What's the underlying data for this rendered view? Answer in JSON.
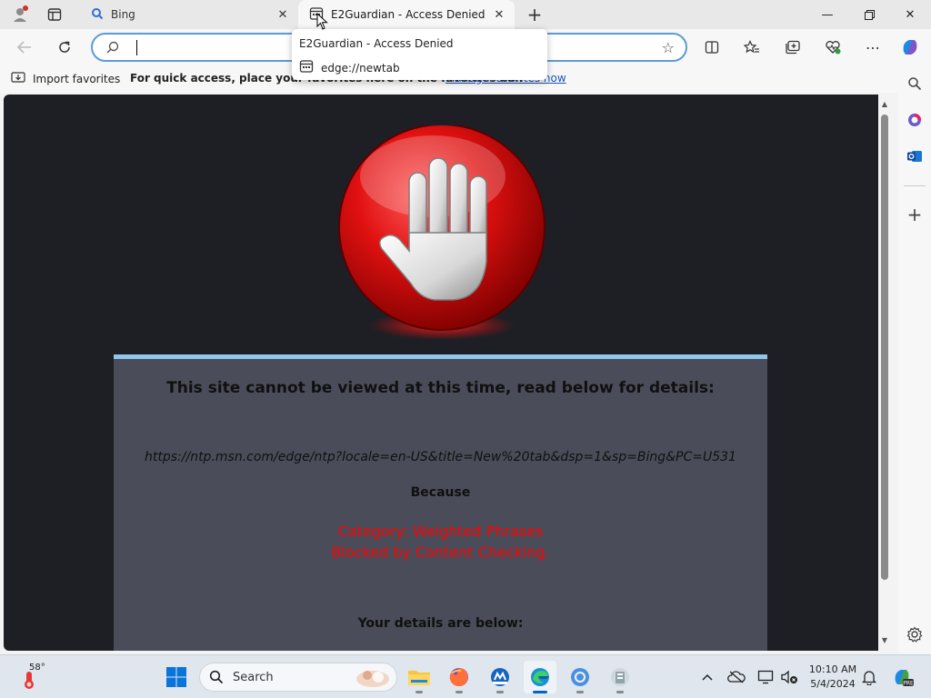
{
  "tabs": [
    {
      "label": "Bing",
      "icon": "bing-search-icon",
      "active": false
    },
    {
      "label": "E2Guardian - Access Denied",
      "icon": "page-icon",
      "active": true
    }
  ],
  "hover_card": {
    "title": "E2Guardian - Access Denied",
    "url": "edge://newtab"
  },
  "address_bar": {
    "value": ""
  },
  "favorites_bar": {
    "import_label": "Import favorites",
    "message": "For quick access, place your favorites here on the favorites bar.",
    "link": "Manage favorites now"
  },
  "page": {
    "heading": "This site cannot be viewed at this time, read below for details:",
    "blocked_url": "https://ntp.msn.com/edge/ntp?locale=en-US&title=New%20tab&dsp=1&sp=Bing&PC=U531",
    "because_label": "Because",
    "reason_lines": [
      "Category: Weighted Phrases",
      "Blocked by Content Checking."
    ],
    "details_heading": "Your details are below:",
    "colors": {
      "background": "#1e1f24",
      "panel": "#4a4d59",
      "panel_border": "#8ec6ee",
      "reason": "#ff0000"
    }
  },
  "taskbar": {
    "weather_temp": "58°",
    "search_placeholder": "Search",
    "apps": [
      "start-menu",
      "file-explorer",
      "firefox",
      "app-icon",
      "edge",
      "chrome",
      "app-icon-2"
    ],
    "clock_time": "10:10 AM",
    "clock_date": "5/4/2024"
  }
}
